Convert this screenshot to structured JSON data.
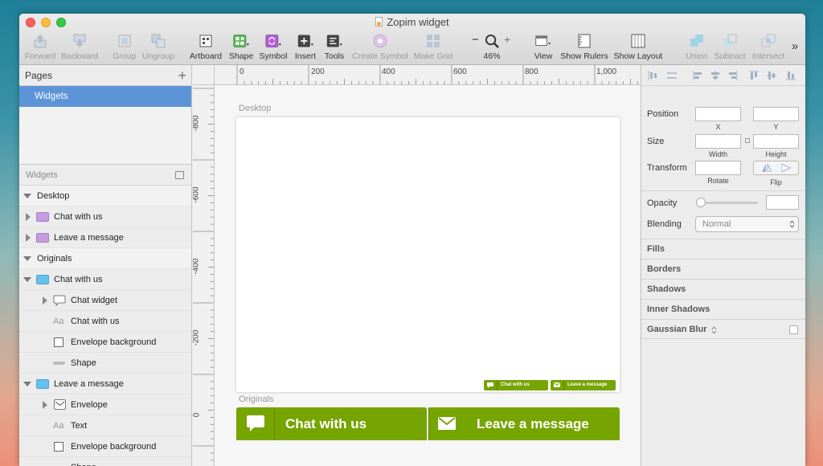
{
  "window": {
    "title": "Zopim widget"
  },
  "toolbar": {
    "forward": "Forward",
    "backward": "Backward",
    "group": "Group",
    "ungroup": "Ungroup",
    "artboard": "Artboard",
    "shape": "Shape",
    "symbol": "Symbol",
    "insert": "Insert",
    "tools": "Tools",
    "create_symbol": "Create Symbol",
    "make_grid": "Make Grid",
    "zoom_minus": "−",
    "zoom_plus": "+",
    "zoom_level": "46%",
    "view": "View",
    "show_rulers": "Show Rulers",
    "show_layout": "Show Layout",
    "union": "Union",
    "subtract": "Subtract",
    "intersect": "Intersect",
    "more": "»"
  },
  "pages": {
    "title": "Pages",
    "add": "+",
    "selected": "Widgets"
  },
  "layers": {
    "title": "Widgets",
    "desktop": "Desktop",
    "desktop_chat": "Chat with us",
    "desktop_leave": "Leave a message",
    "originals": "Originals",
    "orig_chat": "Chat with us",
    "chat_widget": "Chat widget",
    "chat_text_prefix": "Aa",
    "chat_text": "Chat with us",
    "env_bg_1": "Envelope background",
    "shape_1": "Shape",
    "orig_leave": "Leave a message",
    "envelope": "Envelope",
    "text_prefix": "Aa",
    "text": "Text",
    "env_bg_2": "Envelope background",
    "shape_2": "Shape"
  },
  "rulers": {
    "h": [
      "0",
      "200",
      "400",
      "600",
      "800",
      "1,000"
    ],
    "v": [
      "-800",
      "-600",
      "-400",
      "-200",
      "0"
    ]
  },
  "canvas": {
    "desktop_label": "Desktop",
    "originals_label": "Originals",
    "small_chat": "Chat with us",
    "small_leave": "Leave a message",
    "big_chat": "Chat with us",
    "big_leave": "Leave a message",
    "green": "#76a401"
  },
  "inspector": {
    "position": "Position",
    "x": "X",
    "y": "Y",
    "size": "Size",
    "width": "Width",
    "height": "Height",
    "transform": "Transform",
    "rotate": "Rotate",
    "flip": "Flip",
    "opacity": "Opacity",
    "blending": "Blending",
    "blending_value": "Normal",
    "fills": "Fills",
    "borders": "Borders",
    "shadows": "Shadows",
    "inner_shadows": "Inner Shadows",
    "gaussian_blur": "Gaussian Blur"
  }
}
